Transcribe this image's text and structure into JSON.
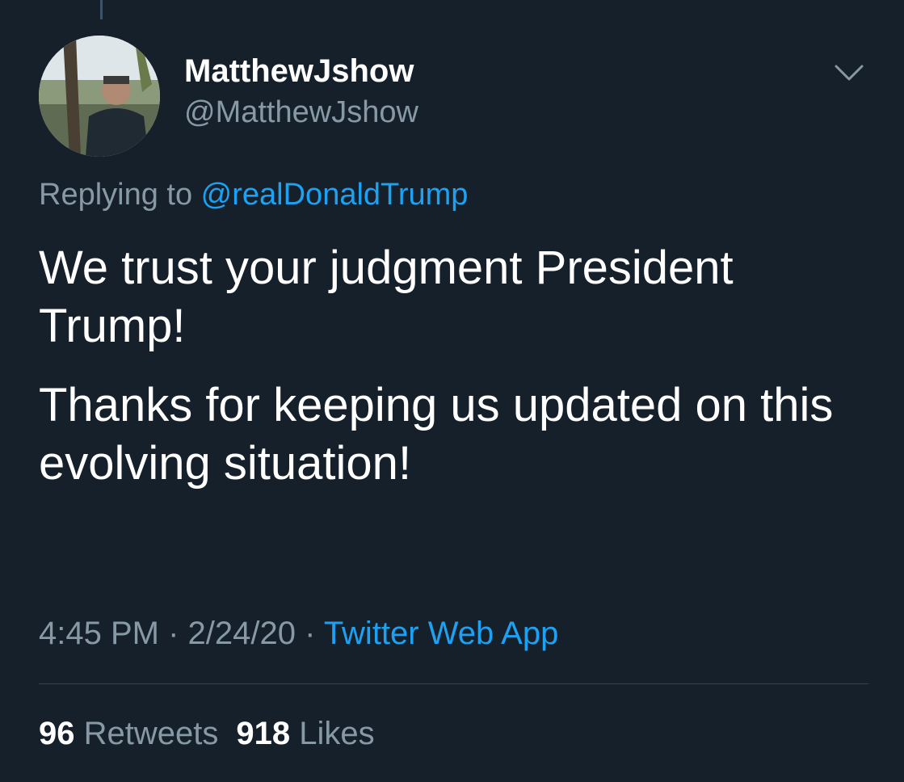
{
  "author": {
    "display_name": "MatthewJshow",
    "handle": "@MatthewJshow"
  },
  "reply": {
    "prefix": "Replying to ",
    "mention": "@realDonaldTrump"
  },
  "text": {
    "paragraph_1": "We trust your judgment President Trump!",
    "paragraph_2": "Thanks for keeping us updated on this evolving situation!"
  },
  "meta": {
    "time": "4:45 PM",
    "separator": " · ",
    "date": "2/24/20",
    "source": "Twitter Web App"
  },
  "stats": {
    "retweets_count": "96",
    "retweets_label": "Retweets",
    "likes_count": "918",
    "likes_label": "Likes"
  },
  "icons": {
    "menu": "chevron-down-icon",
    "avatar": "profile-photo"
  },
  "colors": {
    "background": "#15202b",
    "link": "#1da1f2",
    "secondary_text": "#8899a6",
    "primary_text": "#ffffff",
    "divider": "#38444d"
  }
}
